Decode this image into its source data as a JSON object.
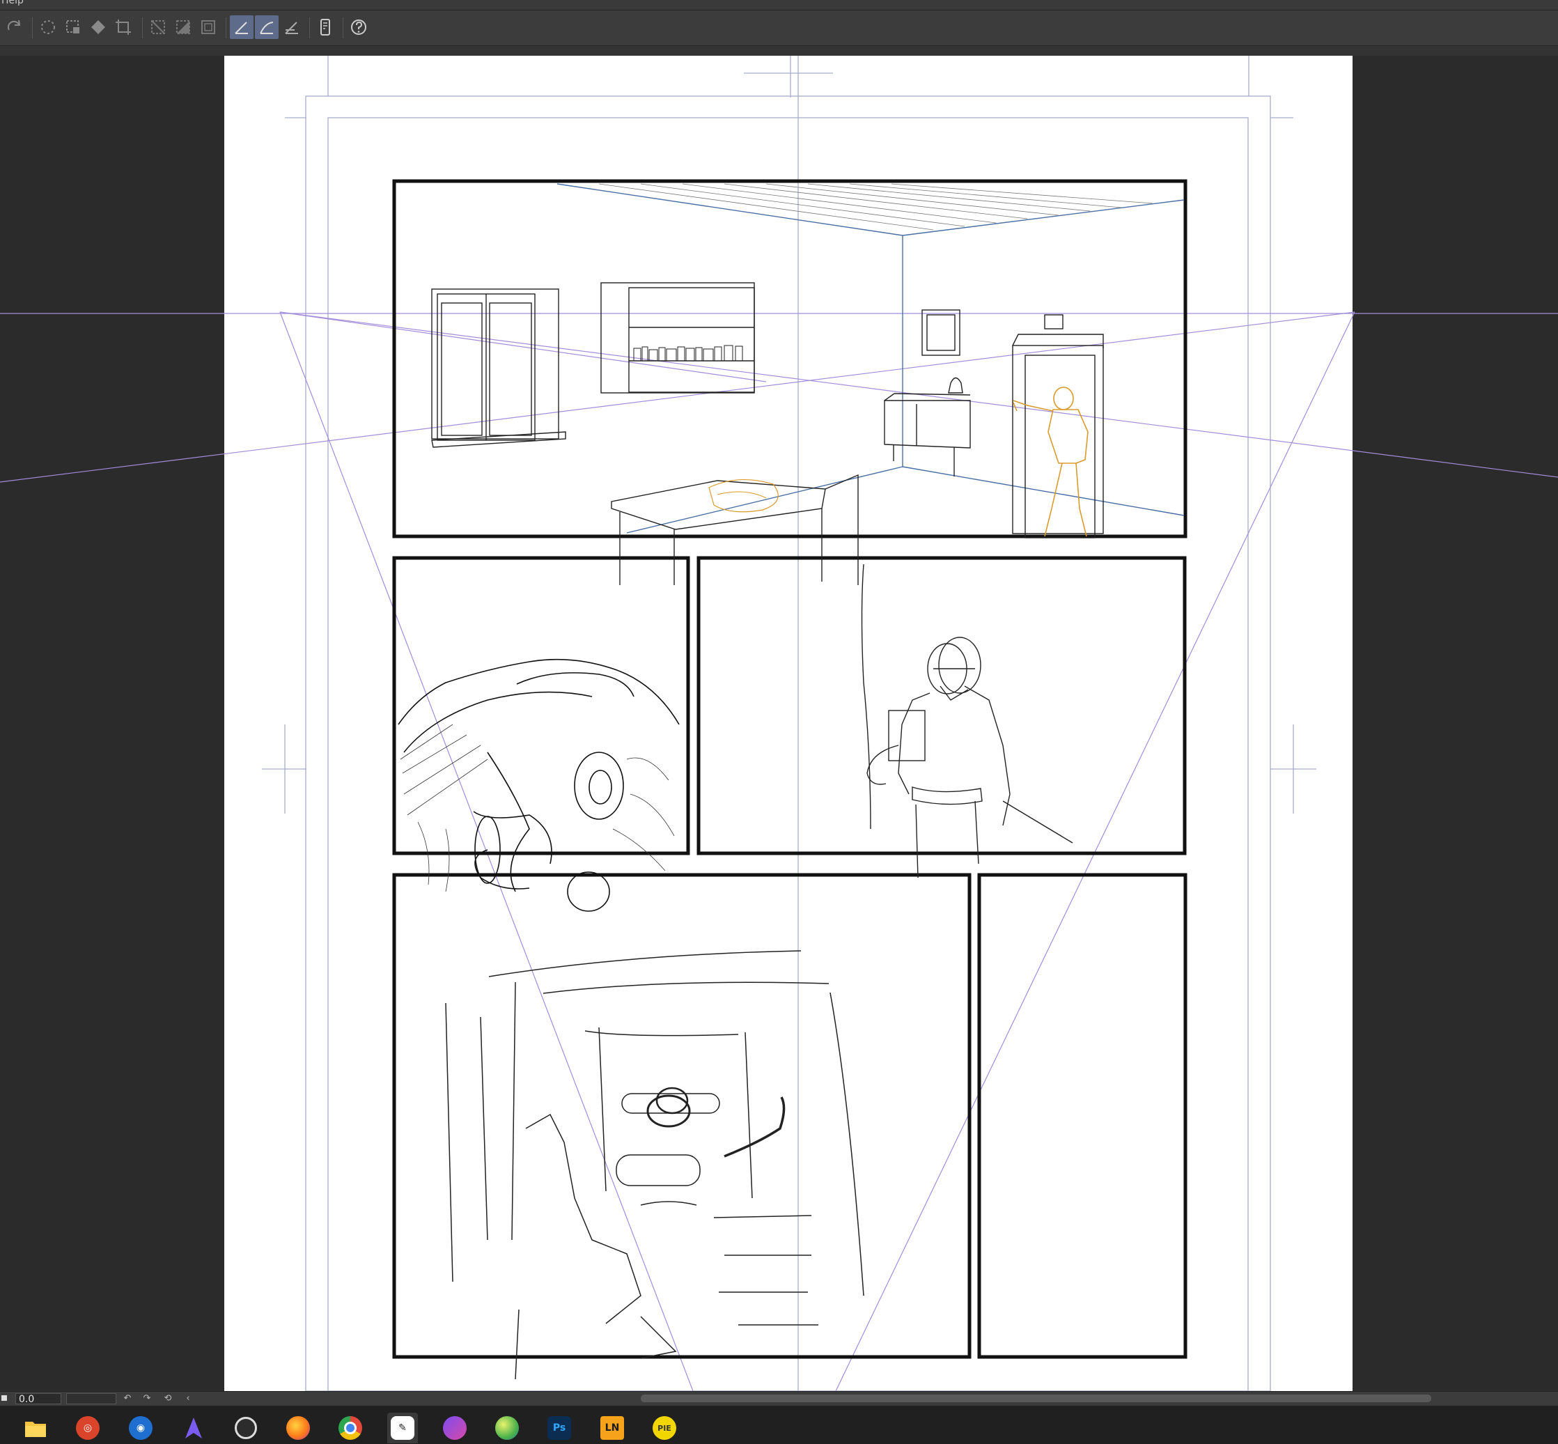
{
  "menu": {
    "partial_label": "Help"
  },
  "toolbar": {
    "tools": [
      {
        "name": "redo-icon",
        "active": false
      },
      {
        "name": "selection-launcher-icon",
        "active": false
      },
      {
        "name": "marquee-select-icon",
        "active": false
      },
      {
        "name": "fill-icon",
        "active": false
      },
      {
        "name": "transform-icon",
        "active": false
      },
      {
        "name": "hide-outside-icon",
        "active": false
      },
      {
        "name": "fill-selection-icon",
        "active": false
      },
      {
        "name": "frame-border-icon",
        "active": false
      },
      {
        "name": "ruler-snap-icon",
        "active": true
      },
      {
        "name": "special-ruler-snap-icon",
        "active": true
      },
      {
        "name": "grid-snap-icon",
        "active": false
      },
      {
        "name": "tablet-icon",
        "active": false
      },
      {
        "name": "help-icon",
        "active": false
      }
    ]
  },
  "status": {
    "rotation_value": "0.0",
    "icons": [
      "rotate-left-icon",
      "rotate-right-icon",
      "reset-rotation-icon",
      "collapse-icon"
    ]
  },
  "taskbar": {
    "apps": [
      {
        "name": "file-explorer",
        "color": "#f4c542",
        "label": ""
      },
      {
        "name": "app-red-swirl",
        "color": "#d9442b",
        "label": ""
      },
      {
        "name": "browser-blue",
        "color": "#1f6fd1",
        "label": ""
      },
      {
        "name": "app-purple-shard",
        "color": "#7b5cf0",
        "label": ""
      },
      {
        "name": "app-target",
        "color": "#2c2c2c",
        "label": ""
      },
      {
        "name": "firefox",
        "color": "#ff7a1a",
        "label": ""
      },
      {
        "name": "chrome",
        "color": "#e5473b",
        "label": ""
      },
      {
        "name": "clip-studio-paint",
        "color": "#ffffff",
        "label": ""
      },
      {
        "name": "app-pink",
        "color": "#d94aa8",
        "label": ""
      },
      {
        "name": "app-green-sphere",
        "color": "#4db34d",
        "label": ""
      },
      {
        "name": "photoshop",
        "color": "#0b2d52",
        "label": "Ps"
      },
      {
        "name": "app-orange-ln",
        "color": "#f7a21b",
        "label": "LN"
      },
      {
        "name": "app-yellow-pie",
        "color": "#f2d600",
        "label": "PIE"
      }
    ]
  },
  "colors": {
    "guide_line": "#9fa3c9",
    "perspective_line": "#9b86d6",
    "frame_border": "#111111",
    "sketch_orange": "#d99a2b",
    "toolbar_active": "#5e6b8a"
  }
}
